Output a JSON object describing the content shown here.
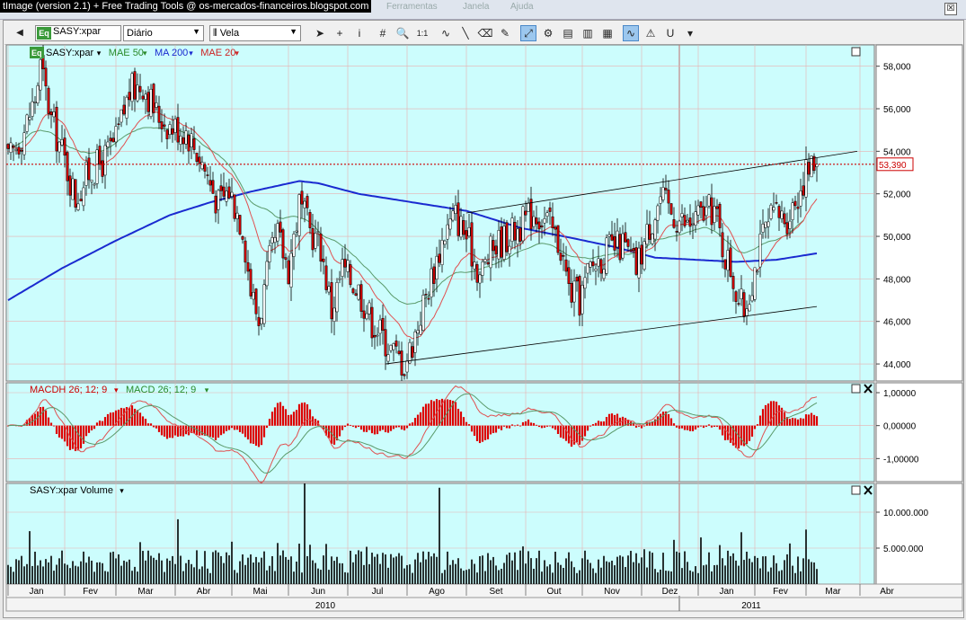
{
  "window": {
    "title": "tImage (version 2.1) + Free Trading Tools @ os-mercados-financeiros.blogspot.com",
    "ghost_menu": [
      "Ferramentas",
      "Janela",
      "Ajuda"
    ],
    "close_glyph": "☒"
  },
  "toolbar": {
    "symbol": "SASY:xpar",
    "symbol_badge": "Eq",
    "period": "Diário",
    "chart_type": "Vela",
    "buttons": [
      {
        "name": "pointer-tool-button",
        "glyph": "➤",
        "active": false
      },
      {
        "name": "crosshair-tool-button",
        "glyph": "+",
        "active": false
      },
      {
        "name": "info-tool-button",
        "glyph": "i",
        "active": false
      },
      {
        "name": "grid-tool-button",
        "glyph": "#",
        "active": false
      },
      {
        "name": "zoom-tool-button",
        "glyph": "🔍",
        "active": false
      },
      {
        "name": "one-to-one-button",
        "glyph": "1:1",
        "active": false
      },
      {
        "name": "indicators-button",
        "glyph": "∿",
        "active": false
      },
      {
        "name": "trendline-tool-button",
        "glyph": "╲",
        "active": false
      },
      {
        "name": "eraser-tool-button",
        "glyph": "⌫",
        "active": false
      },
      {
        "name": "draw-tool-button",
        "glyph": "✎",
        "active": false
      },
      {
        "name": "autoscale-button",
        "glyph": "⤢",
        "active": true
      },
      {
        "name": "settings-tool-button",
        "glyph": "⚙",
        "active": false
      },
      {
        "name": "template-button-1",
        "glyph": "▤",
        "active": false
      },
      {
        "name": "template-button-2",
        "glyph": "▥",
        "active": false
      },
      {
        "name": "template-button-3",
        "glyph": "▦",
        "active": false
      },
      {
        "name": "wave-overlay-button",
        "glyph": "∿",
        "active": true
      },
      {
        "name": "alert-button",
        "glyph": "⚠",
        "active": false
      },
      {
        "name": "magnet-button",
        "glyph": "U",
        "active": false
      },
      {
        "name": "more-button",
        "glyph": "▾",
        "active": false
      }
    ]
  },
  "panels": {
    "price": {
      "legend": [
        {
          "label": "SASY:xpar",
          "color": "#000000",
          "badge": "Eq"
        },
        {
          "label": "MAE 50",
          "color": "#2a8a2a"
        },
        {
          "label": "MA 200",
          "color": "#1a2ad0"
        },
        {
          "label": "MAE 20",
          "color": "#cc2222"
        }
      ],
      "last_price_label": "53,390",
      "yticks": [
        "58,000",
        "56,000",
        "54,000",
        "52,000",
        "50,000",
        "48,000",
        "46,000",
        "44,000"
      ]
    },
    "macd": {
      "legend": [
        {
          "label": "MACDH 26; 12; 9",
          "color": "#cc0000"
        },
        {
          "label": "MACD 26; 12; 9",
          "color": "#2a8a2a"
        }
      ],
      "yticks": [
        "1,00000",
        "0,00000",
        "-1,00000"
      ]
    },
    "volume": {
      "legend": [
        {
          "label": "SASY:xpar Volume",
          "color": "#000000"
        }
      ],
      "yticks": [
        "10.000.000",
        "5.000.000"
      ]
    }
  },
  "xaxis": {
    "months": [
      "Jan",
      "Fev",
      "Mar",
      "Abr",
      "Mai",
      "Jun",
      "Jul",
      "Ago",
      "Set",
      "Out",
      "Nov",
      "Dez",
      "Jan",
      "Fev",
      "Mar",
      "Abr"
    ],
    "years": [
      "2010",
      "2011"
    ]
  },
  "colors": {
    "panel_bg": "#ccfdfd",
    "candle_body": "#cc0000",
    "candle_outline": "#000000",
    "ma200": "#1a2ad0",
    "mae50": "#5a9a6a",
    "mae20": "#e05050",
    "macdh": "#dd0000",
    "volume": "#000000",
    "last_price_line": "#cc0000"
  },
  "chart_data": {
    "type": "candlestick",
    "anchors": [
      [
        0,
        53.5
      ],
      [
        6,
        55
      ],
      [
        10,
        56.5
      ],
      [
        12,
        58
      ],
      [
        16,
        55.5
      ],
      [
        20,
        54
      ],
      [
        25,
        51.8
      ],
      [
        30,
        53
      ],
      [
        35,
        53.5
      ],
      [
        40,
        54.5
      ],
      [
        45,
        56.8
      ],
      [
        50,
        57.2
      ],
      [
        55,
        55.8
      ],
      [
        60,
        55.2
      ],
      [
        66,
        55.0
      ],
      [
        72,
        53.5
      ],
      [
        78,
        51.5
      ],
      [
        82,
        52.2
      ],
      [
        87,
        50.5
      ],
      [
        90,
        47.5
      ],
      [
        93,
        46
      ],
      [
        97,
        48.8
      ],
      [
        100,
        50
      ],
      [
        104,
        48.5
      ],
      [
        108,
        51.5
      ],
      [
        112,
        50.3
      ],
      [
        116,
        49.5
      ],
      [
        120,
        46.5
      ],
      [
        124,
        48.5
      ],
      [
        130,
        47.5
      ],
      [
        135,
        46.0
      ],
      [
        138,
        45.5
      ],
      [
        142,
        44.7
      ],
      [
        147,
        44.0
      ],
      [
        150,
        45.0
      ],
      [
        154,
        46.8
      ],
      [
        158,
        48.5
      ],
      [
        162,
        50.2
      ],
      [
        166,
        51
      ],
      [
        170,
        50
      ],
      [
        175,
        48.2
      ],
      [
        180,
        49.5
      ],
      [
        185,
        50.0
      ],
      [
        190,
        50.5
      ],
      [
        195,
        51.2
      ],
      [
        200,
        50.7
      ],
      [
        205,
        49.5
      ],
      [
        208,
        47.5
      ],
      [
        212,
        47.0
      ],
      [
        216,
        48.5
      ],
      [
        222,
        49.3
      ],
      [
        228,
        49.6
      ],
      [
        233,
        48.5
      ],
      [
        238,
        50.5
      ],
      [
        242,
        51.8
      ],
      [
        247,
        51.0
      ],
      [
        252,
        50.5
      ],
      [
        257,
        51.0
      ],
      [
        262,
        51.3
      ],
      [
        265,
        49.5
      ],
      [
        268,
        48.5
      ],
      [
        271,
        47.0
      ],
      [
        273,
        46.5
      ],
      [
        276,
        48.0
      ],
      [
        280,
        50.0
      ],
      [
        284,
        51.0
      ],
      [
        289,
        50.9
      ],
      [
        293,
        52.0
      ],
      [
        296,
        53.0
      ],
      [
        300,
        53.5
      ]
    ],
    "ma200_anchors": [
      [
        0,
        47.0
      ],
      [
        20,
        48.5
      ],
      [
        40,
        49.8
      ],
      [
        60,
        51.0
      ],
      [
        75,
        51.6
      ],
      [
        90,
        52.1
      ],
      [
        108,
        52.6
      ],
      [
        115,
        52.5
      ],
      [
        130,
        52.0
      ],
      [
        150,
        51.6
      ],
      [
        170,
        51.2
      ],
      [
        190,
        50.4
      ],
      [
        210,
        49.9
      ],
      [
        225,
        49.5
      ],
      [
        240,
        49.0
      ],
      [
        255,
        48.9
      ],
      [
        270,
        48.8
      ],
      [
        285,
        48.9
      ],
      [
        300,
        49.2
      ]
    ],
    "trendline_upper": [
      [
        170,
        51.1
      ],
      [
        315,
        54.0
      ]
    ],
    "trendline_lower": [
      [
        140,
        44.0
      ],
      [
        300,
        46.7
      ]
    ],
    "price_range": [
      43.2,
      59.0
    ],
    "macd_range": [
      -1.7,
      1.3
    ],
    "volume_max": 14000000,
    "last_price": 53.39,
    "spikes": [
      [
        110,
        14000000
      ],
      [
        160,
        13400000
      ]
    ],
    "seed": 17
  }
}
